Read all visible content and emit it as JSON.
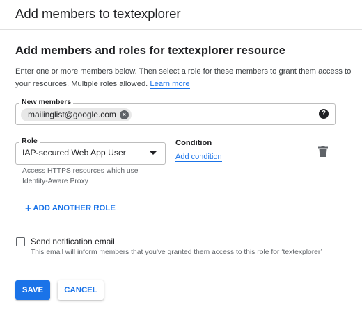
{
  "dialog": {
    "title": "Add members to textexplorer"
  },
  "section": {
    "heading": "Add members and roles for textexplorer resource",
    "intro_text": "Enter one or more members below. Then select a role for these members to grant them access to your resources. Multiple roles allowed.",
    "learn_more": "Learn more"
  },
  "members": {
    "label": "New members",
    "chips": [
      "mailinglist@google.com"
    ],
    "remove_icon": "cancel-circle-icon",
    "help_icon": "help-icon"
  },
  "role": {
    "label": "Role",
    "value": "IAP-secured Web App User",
    "description": "Access HTTPS resources which use Identity-Aware Proxy"
  },
  "condition": {
    "title": "Condition",
    "link": "Add condition"
  },
  "actions": {
    "add_role": "ADD ANOTHER ROLE",
    "save": "SAVE",
    "cancel": "CANCEL"
  },
  "notification": {
    "label": "Send notification email",
    "checked": false,
    "description": "This email will inform members that you've granted them access to this role for ‘textexplorer’"
  },
  "colors": {
    "accent": "#1a73e8",
    "text": "#202124",
    "muted": "#5f6368",
    "border": "#bdbdbd"
  }
}
